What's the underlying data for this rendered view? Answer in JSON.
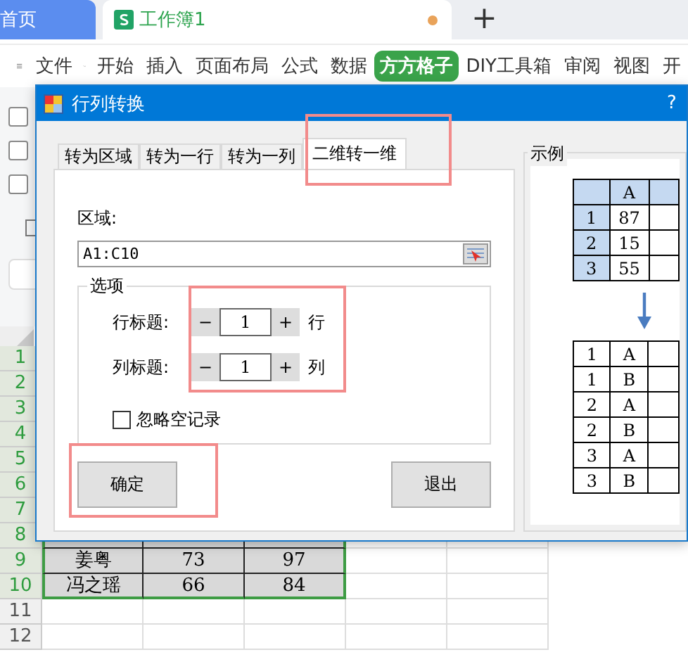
{
  "tab_bar": {
    "tabs": [
      {
        "label": "首页",
        "kind": "home",
        "selected": false,
        "unsaved": false
      },
      {
        "label": "工作簿1",
        "kind": "workbook",
        "selected": true,
        "unsaved": true
      }
    ],
    "new_tab": "+"
  },
  "menu": [
    {
      "label": "文件",
      "dropdown": true,
      "selected": false
    },
    {
      "label": "开始",
      "dropdown": false,
      "selected": false
    },
    {
      "label": "插入",
      "dropdown": false,
      "selected": false
    },
    {
      "label": "页面布局",
      "dropdown": false,
      "selected": false
    },
    {
      "label": "公式",
      "dropdown": false,
      "selected": false
    },
    {
      "label": "数据",
      "dropdown": false,
      "selected": false
    },
    {
      "label": "方方格子",
      "dropdown": false,
      "selected": true
    },
    {
      "label": "DIY工具箱",
      "dropdown": false,
      "selected": false
    },
    {
      "label": "审阅",
      "dropdown": false,
      "selected": false
    },
    {
      "label": "视图",
      "dropdown": false,
      "selected": false
    },
    {
      "label": "开",
      "dropdown": false,
      "selected": false
    }
  ],
  "left_panel": {
    "checkboxes": [
      {
        "checked": false
      },
      {
        "checked": false
      },
      {
        "checked": false
      }
    ]
  },
  "sheet": {
    "rows": [
      {
        "number": "1",
        "selected": true
      },
      {
        "number": "2",
        "selected": true
      },
      {
        "number": "3",
        "selected": true
      },
      {
        "number": "4",
        "selected": true
      },
      {
        "number": "5",
        "selected": true
      },
      {
        "number": "6",
        "selected": true
      },
      {
        "number": "7",
        "selected": true
      },
      {
        "number": "8",
        "selected": true
      },
      {
        "number": "9",
        "selected": true,
        "cells": [
          "姜粤",
          "73",
          "97"
        ]
      },
      {
        "number": "10",
        "selected": true,
        "cells": [
          "冯之瑶",
          "66",
          "84"
        ]
      },
      {
        "number": "11",
        "selected": false
      },
      {
        "number": "12",
        "selected": false
      }
    ]
  },
  "dialog": {
    "title": "行列转换",
    "help": "?",
    "tabs": [
      {
        "label": "转为区域",
        "selected": false,
        "highlighted": false
      },
      {
        "label": "转为一行",
        "selected": false,
        "highlighted": false
      },
      {
        "label": "转为一列",
        "selected": false,
        "highlighted": false
      },
      {
        "label": "二维转一维",
        "selected": true,
        "highlighted": true
      }
    ],
    "region_label": "区域:",
    "region_value": "A1:C10",
    "options": {
      "title": "选项",
      "highlighted": true,
      "spinners": [
        {
          "label": "行标题:",
          "minus": "−",
          "value": "1",
          "plus": "+",
          "unit": "行"
        },
        {
          "label": "列标题:",
          "minus": "−",
          "value": "1",
          "plus": "+",
          "unit": "列"
        }
      ],
      "checkbox": {
        "label": "忽略空记录",
        "checked": false
      }
    },
    "buttons": [
      {
        "label": "确定",
        "highlighted": true
      },
      {
        "label": "退出",
        "highlighted": false
      }
    ],
    "example": {
      "title": "示例",
      "source_header": [
        "A"
      ],
      "source_rows": [
        {
          "label": "1",
          "cells": [
            "87"
          ]
        },
        {
          "label": "2",
          "cells": [
            "15"
          ]
        },
        {
          "label": "3",
          "cells": [
            "55"
          ]
        }
      ],
      "result_rows": [
        [
          "1",
          "A"
        ],
        [
          "1",
          "B"
        ],
        [
          "2",
          "A"
        ],
        [
          "2",
          "B"
        ],
        [
          "3",
          "A"
        ],
        [
          "3",
          "B"
        ]
      ]
    }
  }
}
